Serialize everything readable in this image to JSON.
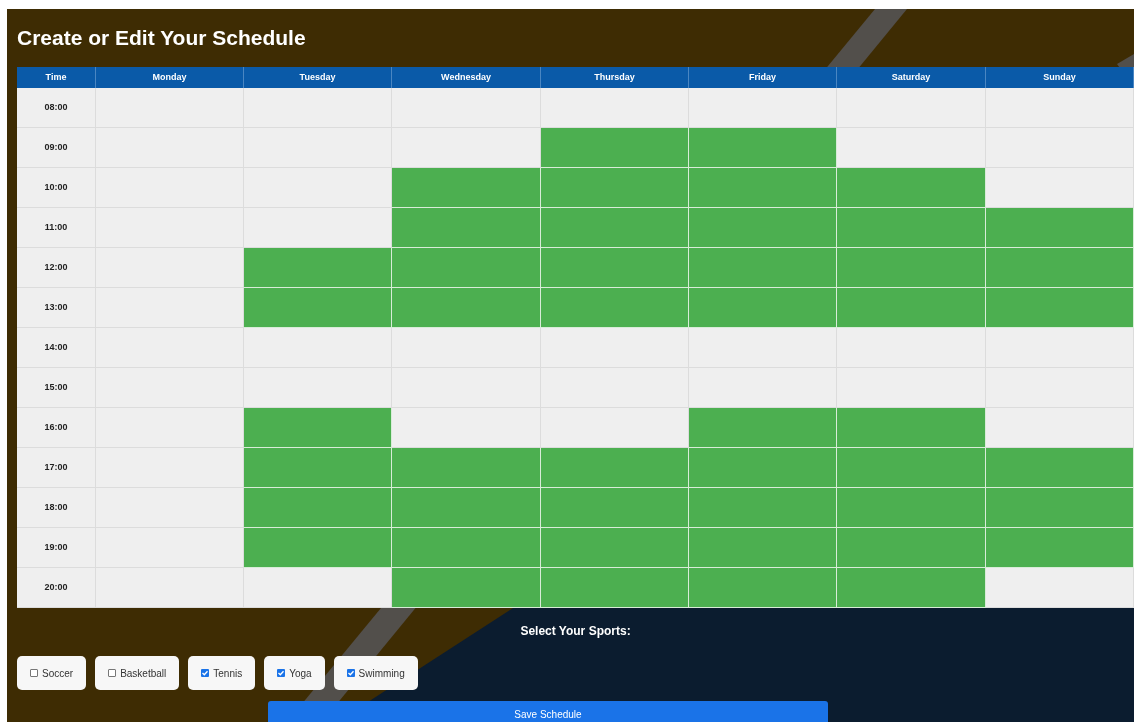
{
  "title": "Create or Edit Your Schedule",
  "columns": [
    "Time",
    "Monday",
    "Tuesday",
    "Wednesday",
    "Thursday",
    "Friday",
    "Saturday",
    "Sunday"
  ],
  "rows": [
    {
      "time": "08:00",
      "cells": [
        {
          "selected": false
        },
        {
          "selected": false
        },
        {
          "selected": false
        },
        {
          "selected": false
        },
        {
          "selected": false
        },
        {
          "selected": false
        },
        {
          "selected": false
        }
      ]
    },
    {
      "time": "09:00",
      "cells": [
        {
          "selected": false
        },
        {
          "selected": false
        },
        {
          "selected": false
        },
        {
          "selected": true
        },
        {
          "selected": true
        },
        {
          "selected": false
        },
        {
          "selected": false
        }
      ]
    },
    {
      "time": "10:00",
      "cells": [
        {
          "selected": false
        },
        {
          "selected": false
        },
        {
          "selected": true
        },
        {
          "selected": true
        },
        {
          "selected": true
        },
        {
          "selected": true
        },
        {
          "selected": false
        }
      ]
    },
    {
      "time": "11:00",
      "cells": [
        {
          "selected": false
        },
        {
          "selected": false
        },
        {
          "selected": true
        },
        {
          "selected": true
        },
        {
          "selected": true
        },
        {
          "selected": true
        },
        {
          "selected": true
        }
      ]
    },
    {
      "time": "12:00",
      "cells": [
        {
          "selected": false
        },
        {
          "selected": true
        },
        {
          "selected": true
        },
        {
          "selected": true
        },
        {
          "selected": true
        },
        {
          "selected": true
        },
        {
          "selected": true
        }
      ]
    },
    {
      "time": "13:00",
      "cells": [
        {
          "selected": false
        },
        {
          "selected": true
        },
        {
          "selected": true
        },
        {
          "selected": true
        },
        {
          "selected": true
        },
        {
          "selected": true
        },
        {
          "selected": true
        }
      ]
    },
    {
      "time": "14:00",
      "cells": [
        {
          "selected": false
        },
        {
          "selected": false
        },
        {
          "selected": false
        },
        {
          "selected": false
        },
        {
          "selected": false
        },
        {
          "selected": false
        },
        {
          "selected": false
        }
      ]
    },
    {
      "time": "15:00",
      "cells": [
        {
          "selected": false
        },
        {
          "selected": false
        },
        {
          "selected": false
        },
        {
          "selected": false
        },
        {
          "selected": false
        },
        {
          "selected": false
        },
        {
          "selected": false
        }
      ]
    },
    {
      "time": "16:00",
      "cells": [
        {
          "selected": false
        },
        {
          "selected": true
        },
        {
          "selected": false
        },
        {
          "selected": false
        },
        {
          "selected": true
        },
        {
          "selected": true
        },
        {
          "selected": false
        }
      ]
    },
    {
      "time": "17:00",
      "cells": [
        {
          "selected": false
        },
        {
          "selected": true
        },
        {
          "selected": true
        },
        {
          "selected": true
        },
        {
          "selected": true
        },
        {
          "selected": true
        },
        {
          "selected": true
        }
      ]
    },
    {
      "time": "18:00",
      "cells": [
        {
          "selected": false
        },
        {
          "selected": true
        },
        {
          "selected": true
        },
        {
          "selected": true
        },
        {
          "selected": true
        },
        {
          "selected": true
        },
        {
          "selected": true
        }
      ]
    },
    {
      "time": "19:00",
      "cells": [
        {
          "selected": false
        },
        {
          "selected": true
        },
        {
          "selected": true
        },
        {
          "selected": true
        },
        {
          "selected": true
        },
        {
          "selected": true
        },
        {
          "selected": true
        }
      ]
    },
    {
      "time": "20:00",
      "cells": [
        {
          "selected": false
        },
        {
          "selected": false
        },
        {
          "selected": true
        },
        {
          "selected": true
        },
        {
          "selected": true
        },
        {
          "selected": true
        },
        {
          "selected": false
        }
      ]
    }
  ],
  "sports_label": "Select Your Sports:",
  "sports": [
    {
      "label": "Soccer",
      "checked": false
    },
    {
      "label": "Basketball",
      "checked": false
    },
    {
      "label": "Tennis",
      "checked": true
    },
    {
      "label": "Yoga",
      "checked": true
    },
    {
      "label": "Swimming",
      "checked": true
    }
  ],
  "save_button": "Save Schedule"
}
